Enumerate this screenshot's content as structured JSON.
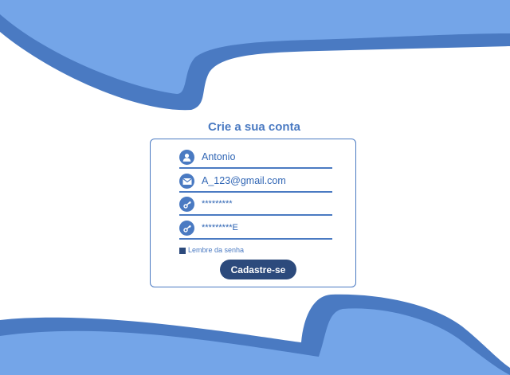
{
  "colors": {
    "accent": "#4a7ac2",
    "wave_light": "#74a5e8",
    "button": "#2c4a7c"
  },
  "form": {
    "title": "Crie a sua conta",
    "fields": [
      {
        "icon": "user-icon",
        "value": "Antonio"
      },
      {
        "icon": "email-icon",
        "value": "A_123@gmail.com"
      },
      {
        "icon": "key-icon",
        "value": "*********"
      },
      {
        "icon": "key-icon",
        "value": "*********E"
      }
    ],
    "remember_label": "Lembre da senha",
    "submit_label": "Cadastre-se"
  }
}
